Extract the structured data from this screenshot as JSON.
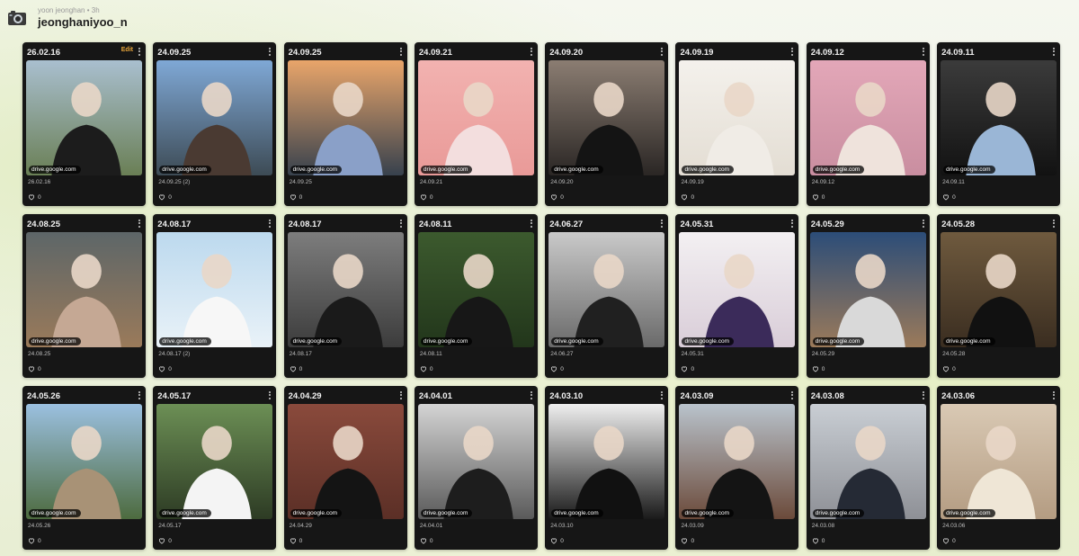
{
  "header": {
    "avatar_icon": "camera-icon",
    "subline": "yoon jeonghan • 3h",
    "username": "jeonghaniyoo_n"
  },
  "cards": [
    {
      "date": "26.02.16",
      "edit": "Edit",
      "domain": "drive.google.com",
      "caption": "26.02.16",
      "likes": "0",
      "bg": [
        "#a9bfcf",
        "#6a7f55"
      ],
      "figure": "#1c1c1c"
    },
    {
      "date": "24.09.25",
      "domain": "drive.google.com",
      "caption": "24.09.25 (2)",
      "likes": "0",
      "bg": [
        "#7fa8d6",
        "#3d4b55"
      ],
      "figure": "#4a3a32"
    },
    {
      "date": "24.09.25",
      "domain": "drive.google.com",
      "caption": "24.09.25",
      "likes": "0",
      "bg": [
        "#e9a56a",
        "#37414d"
      ],
      "figure": "#8aa0c8"
    },
    {
      "date": "24.09.21",
      "domain": "drive.google.com",
      "caption": "24.09.21",
      "likes": "0",
      "bg": [
        "#f2b2b0",
        "#e99a98"
      ],
      "figure": "#f3dede"
    },
    {
      "date": "24.09.20",
      "domain": "drive.google.com",
      "caption": "24.09.20",
      "likes": "0",
      "bg": [
        "#8b7d72",
        "#2a2624"
      ],
      "figure": "#141414"
    },
    {
      "date": "24.09.19",
      "domain": "drive.google.com",
      "caption": "24.09.19",
      "likes": "0",
      "bg": [
        "#f4f1ec",
        "#e3ddd3"
      ],
      "figure": "#f0ece6"
    },
    {
      "date": "24.09.12",
      "domain": "drive.google.com",
      "caption": "24.09.12",
      "likes": "0",
      "bg": [
        "#e3a7b8",
        "#c98ea0"
      ],
      "figure": "#efe3dc"
    },
    {
      "date": "24.09.11",
      "domain": "drive.google.com",
      "caption": "24.09.11",
      "likes": "0",
      "bg": [
        "#3b3b3b",
        "#121212"
      ],
      "figure": "#9ab6d6"
    },
    {
      "date": "24.08.25",
      "domain": "drive.google.com",
      "caption": "24.08.25",
      "likes": "0",
      "bg": [
        "#5d6668",
        "#9a7a5a"
      ],
      "figure": "#c5a894"
    },
    {
      "date": "24.08.17",
      "domain": "drive.google.com",
      "caption": "24.08.17 (2)",
      "likes": "0",
      "bg": [
        "#bcd9ee",
        "#e9f2f8"
      ],
      "figure": "#f7f7f7"
    },
    {
      "date": "24.08.17",
      "domain": "drive.google.com",
      "caption": "24.08.17",
      "likes": "0",
      "bg": [
        "#7d7d7d",
        "#3c3c3c"
      ],
      "figure": "#1a1a1a"
    },
    {
      "date": "24.08.11",
      "domain": "drive.google.com",
      "caption": "24.08.11",
      "likes": "0",
      "bg": [
        "#3c5a2e",
        "#22361b"
      ],
      "figure": "#171717"
    },
    {
      "date": "24.06.27",
      "domain": "drive.google.com",
      "caption": "24.06.27",
      "likes": "0",
      "bg": [
        "#c9c9c9",
        "#6a6a6a"
      ],
      "figure": "#202020"
    },
    {
      "date": "24.05.31",
      "domain": "drive.google.com",
      "caption": "24.05.31",
      "likes": "0",
      "bg": [
        "#f3f0f2",
        "#d9cdd8"
      ],
      "figure": "#3b2b5a"
    },
    {
      "date": "24.05.29",
      "domain": "drive.google.com",
      "caption": "24.05.29",
      "likes": "0",
      "bg": [
        "#2c4d78",
        "#9b7a5a"
      ],
      "figure": "#d9d9d9"
    },
    {
      "date": "24.05.28",
      "domain": "drive.google.com",
      "caption": "24.05.28",
      "likes": "0",
      "bg": [
        "#6f5a3e",
        "#3a2d20"
      ],
      "figure": "#111111"
    },
    {
      "date": "24.05.26",
      "domain": "drive.google.com",
      "caption": "24.05.26",
      "likes": "0",
      "bg": [
        "#9bc0e0",
        "#4d6b3f"
      ],
      "figure": "#a89276"
    },
    {
      "date": "24.05.17",
      "domain": "drive.google.com",
      "caption": "24.05.17",
      "likes": "0",
      "bg": [
        "#6c8f55",
        "#2d3b24"
      ],
      "figure": "#f4f4f4"
    },
    {
      "date": "24.04.29",
      "domain": "drive.google.com",
      "caption": "24.04.29",
      "likes": "0",
      "bg": [
        "#8a4a3c",
        "#5b2f26"
      ],
      "figure": "#141414"
    },
    {
      "date": "24.04.01",
      "domain": "drive.google.com",
      "caption": "24.04.01",
      "likes": "0",
      "bg": [
        "#d4d4d4",
        "#5a5a5a"
      ],
      "figure": "#1d1d1d"
    },
    {
      "date": "24.03.10",
      "domain": "drive.google.com",
      "caption": "24.03.10",
      "likes": "0",
      "bg": [
        "#efefef",
        "#1a1a1a"
      ],
      "figure": "#111111"
    },
    {
      "date": "24.03.09",
      "domain": "drive.google.com",
      "caption": "24.03.09",
      "likes": "0",
      "bg": [
        "#b9c3cc",
        "#6b4a3a"
      ],
      "figure": "#141414"
    },
    {
      "date": "24.03.08",
      "domain": "drive.google.com",
      "caption": "24.03.08",
      "likes": "0",
      "bg": [
        "#c9ced4",
        "#8e9096"
      ],
      "figure": "#252a35"
    },
    {
      "date": "24.03.06",
      "domain": "drive.google.com",
      "caption": "24.03.06",
      "likes": "0",
      "bg": [
        "#d9c9b4",
        "#b49c82"
      ],
      "figure": "#efe6d6"
    }
  ]
}
